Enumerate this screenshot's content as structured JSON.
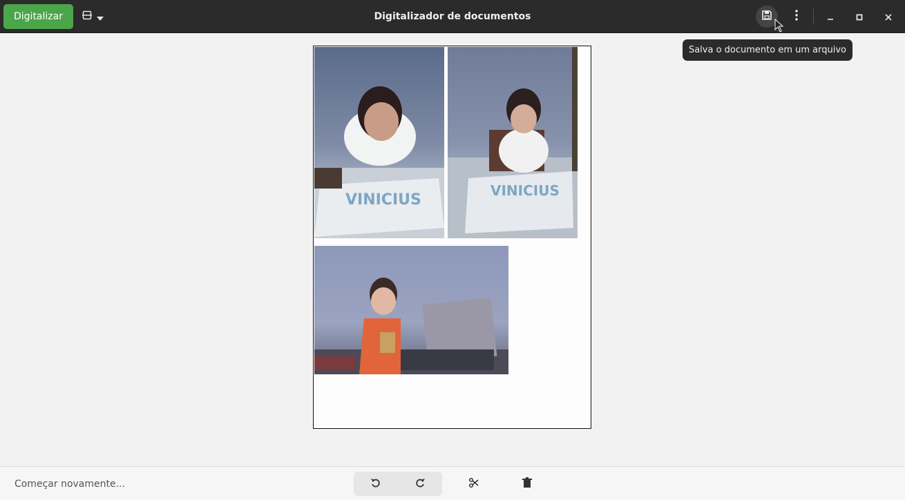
{
  "header": {
    "scan_label": "Digitalizar",
    "title": "Digitalizador de documentos",
    "save_tooltip": "Salva o documento em um arquivo",
    "icons": {
      "scan_type": "scanner-icon",
      "dropdown": "chevron-down-icon",
      "save": "save-icon",
      "menu": "vertical-dots-icon",
      "minimize": "minimize-icon",
      "maximize": "maximize-icon",
      "close": "close-icon"
    },
    "accent_color": "#4ba64a"
  },
  "document": {
    "pages": [
      {
        "photos": [
          {
            "description_name": "photo-birthday-cake-1"
          },
          {
            "description_name": "photo-birthday-cake-2"
          },
          {
            "description_name": "photo-record-player"
          }
        ]
      }
    ]
  },
  "bottombar": {
    "restart_label": "Começar novamente...",
    "icons": {
      "rotate_left": "rotate-left-icon",
      "rotate_right": "rotate-right-icon",
      "crop": "scissors-icon",
      "delete": "trash-icon"
    }
  }
}
